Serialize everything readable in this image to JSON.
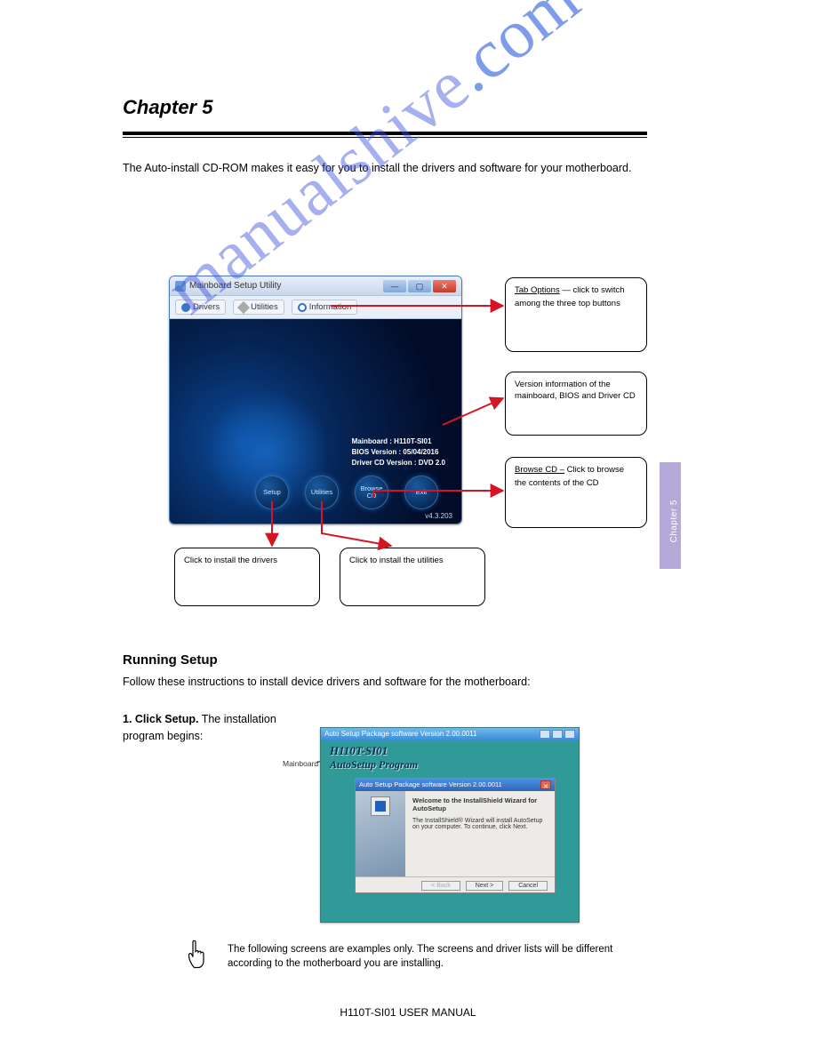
{
  "header": {
    "chapter": "Chapter 5",
    "topright": ""
  },
  "intro": "The Auto-install CD-ROM makes it easy for you to install the drivers and software for your motherboard.",
  "tab_options_label": "Tab Options —  click to switch  among the three  top buttons",
  "mbwin": {
    "title": "Mainboard Setup Utility",
    "tabs": {
      "drivers": "Drivers",
      "utilities": "Utilities",
      "information": "Information"
    },
    "info": {
      "mainboard": "Mainboard : H110T-SI01",
      "bios": "BIOS Version : 05/04/2016",
      "cdver": "Driver CD Version : DVD 2.0"
    },
    "buttons": {
      "setup": "Setup",
      "utilities": "Utilities",
      "browse": "Browse CD",
      "exit": "Exit"
    },
    "version": "v4.3.203"
  },
  "callouts": {
    "c1": {
      "hd": "Tab Options",
      "body": " — click to switch among the three top buttons"
    },
    "c2": {
      "body": "Version information of the mainboard, BIOS and Driver CD"
    },
    "c3": {
      "hd": "Browse CD –",
      "body": " Click to browse the contents of the CD"
    },
    "c4": {
      "body": "Click to install the drivers"
    },
    "c5": {
      "body": "Click to install the utilities"
    }
  },
  "run": {
    "heading": "Running Setup",
    "p1": "Follow these instructions to install device drivers and software for the motherboard:",
    "p2a": "1. Click Setup.",
    "p2b": "The installation program begins:",
    "mbid_label": "Mainboard ID"
  },
  "setupwin": {
    "topbar": "Auto Setup Package software Version 2.00.0011",
    "brand1": "H110T-SI01",
    "brand2": "AutoSetup Program",
    "dialog_title": "Auto Setup Package software Version 2.00.0011",
    "dialog_heading": "Welcome to the InstallShield Wizard for AutoSetup",
    "dialog_body": "The InstallShield® Wizard will install AutoSetup on your computer. To continue, click Next.",
    "btn_back": "< Back",
    "btn_next": "Next >",
    "btn_cancel": "Cancel"
  },
  "note": "The following screens are examples only. The screens and driver lists will be different according to the motherboard you are installing.",
  "footer": "H110T-SI01 USER MANUAL",
  "watermark": {
    "a": "manualshive",
    "b": ".com"
  },
  "right_rail": "Chapter 5"
}
